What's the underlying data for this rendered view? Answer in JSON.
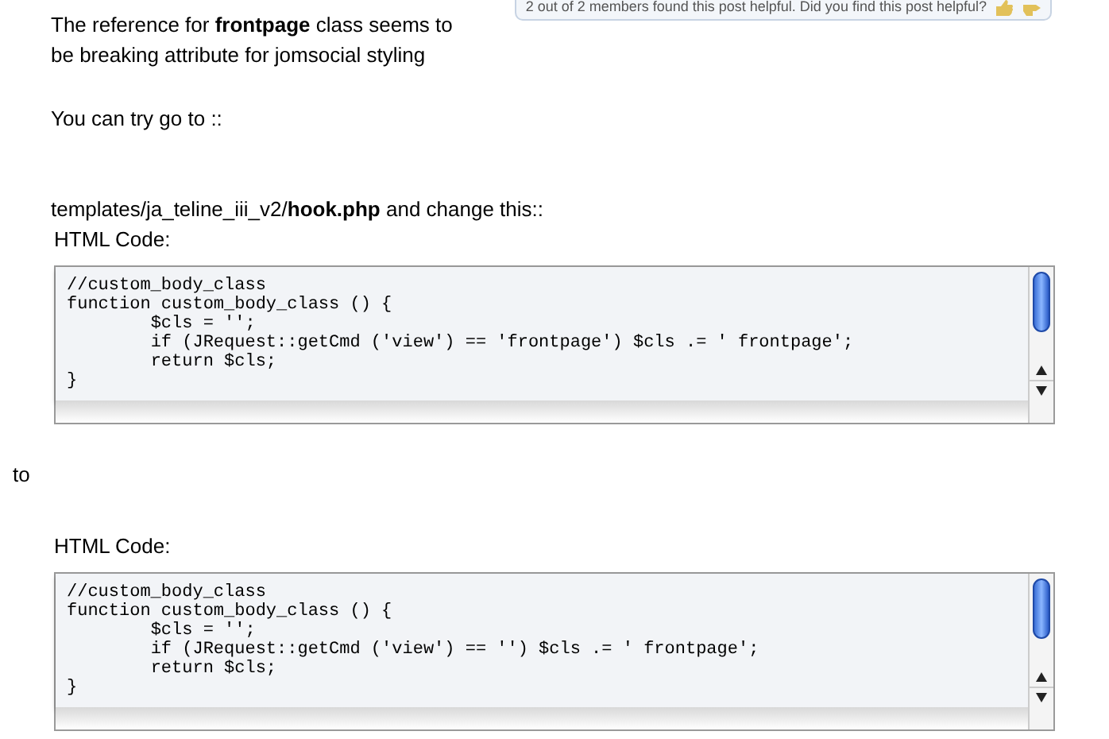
{
  "helpful_bar": {
    "text": "2 out of 2 members found this post helpful. Did you find this post helpful?"
  },
  "paragraphs": [
    {
      "text": "The reference for **frontpage** class seems to be breaking attribute for jomsocial styling"
    },
    {
      "text": "You can try go to ::"
    },
    {
      "text": "templates/ja_teline_iii_v2/**hook.php** and change this::"
    }
  ],
  "code_blocks": [
    {
      "label": "HTML Code:",
      "lines": [
        "//custom_body_class",
        "function custom_body_class () {",
        "\t$cls = '';",
        "\tif (JRequest::getCmd ('view') == 'frontpage') $cls .= ' frontpage';",
        "\treturn $cls;",
        "}"
      ]
    },
    {
      "label": "HTML Code:",
      "lines": [
        "//custom_body_class",
        "function custom_body_class () {",
        "\t$cls = '';",
        "\tif (JRequest::getCmd ('view') == '') $cls .= ' frontpage';",
        "\treturn $cls;",
        "}"
      ]
    }
  ],
  "between_text": "to"
}
